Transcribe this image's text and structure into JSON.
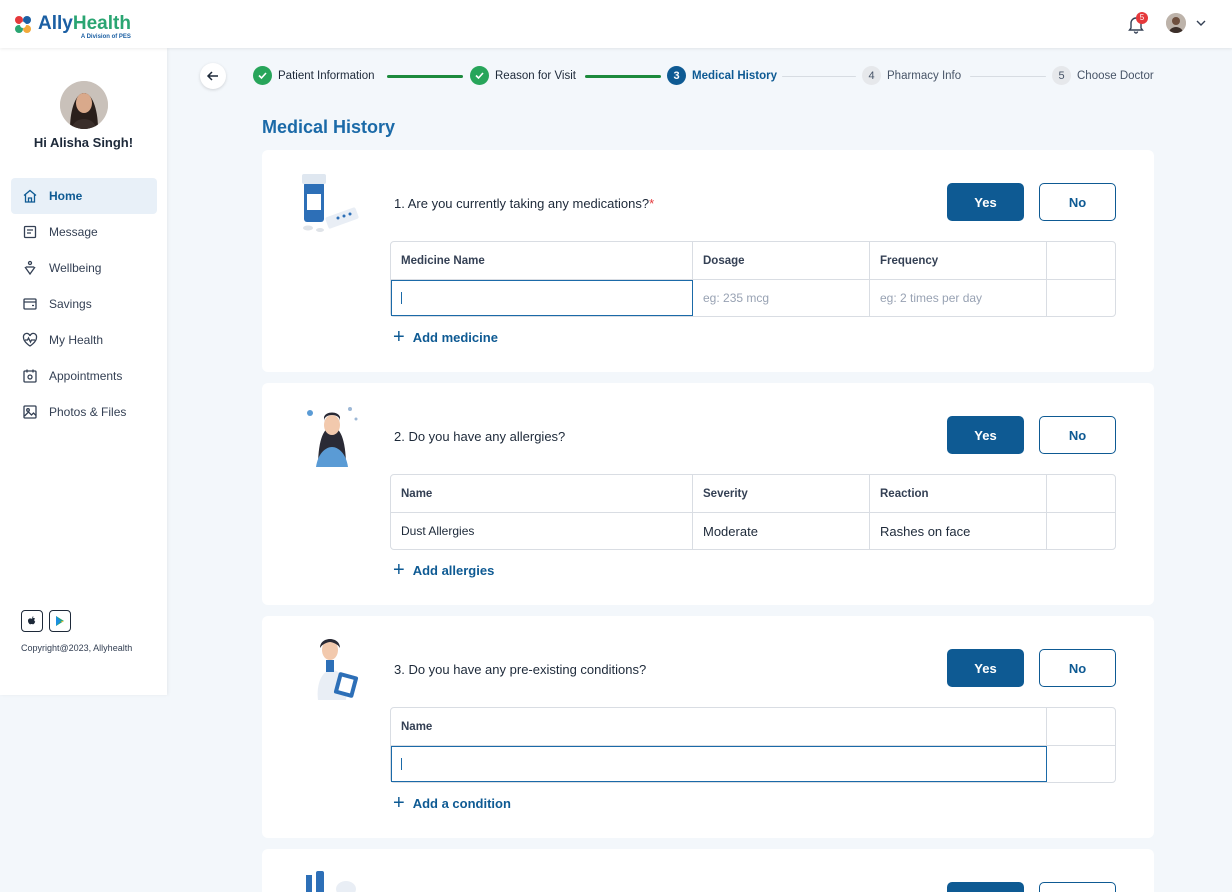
{
  "app": {
    "logo_a": "Ally",
    "logo_b": "Health",
    "logo_sub": "A Division of PES",
    "notification_count": "5"
  },
  "sidebar": {
    "greeting": "Hi Alisha Singh!",
    "items": [
      {
        "label": "Home",
        "icon": "home-icon",
        "active": true
      },
      {
        "label": "Message",
        "icon": "message-icon"
      },
      {
        "label": "Wellbeing",
        "icon": "wellbeing-icon"
      },
      {
        "label": "Savings",
        "icon": "wallet-icon"
      },
      {
        "label": "My Health",
        "icon": "heart-pulse-icon"
      },
      {
        "label": "Appointments",
        "icon": "calendar-icon"
      },
      {
        "label": "Photos & Files",
        "icon": "image-icon"
      }
    ],
    "copyright": "Copyright@2023, Allyhealth"
  },
  "stepper": {
    "steps": [
      {
        "num": "1",
        "label": "Patient Information",
        "state": "done"
      },
      {
        "num": "2",
        "label": "Reason for Visit",
        "state": "done"
      },
      {
        "num": "3",
        "label": "Medical History",
        "state": "current"
      },
      {
        "num": "4",
        "label": "Pharmacy Info",
        "state": "todo"
      },
      {
        "num": "5",
        "label": "Choose Doctor",
        "state": "todo"
      }
    ]
  },
  "page_title": "Medical History",
  "yes_label": "Yes",
  "no_label": "No",
  "q1": {
    "question": "1. Are you currently taking any medications?",
    "required_mark": "*",
    "headers": [
      "Medicine Name",
      "Dosage",
      "Frequency"
    ],
    "row": {
      "name": "",
      "dosage_placeholder": "eg: 235 mcg",
      "frequency_placeholder": "eg: 2 times per day"
    },
    "add_label": "Add medicine"
  },
  "q2": {
    "question": "2. Do you have any allergies?",
    "headers": [
      "Name",
      "Severity",
      "Reaction"
    ],
    "row": {
      "name": "Dust Allergies",
      "severity": "Moderate",
      "reaction": "Rashes on face"
    },
    "add_label": "Add allergies"
  },
  "q3": {
    "question": "3. Do you have any pre-existing conditions?",
    "headers": [
      "Name"
    ],
    "add_label": "Add a condition"
  },
  "colors": {
    "primary": "#0e5a93",
    "success": "#27a55a",
    "badge": "#e5383b"
  }
}
